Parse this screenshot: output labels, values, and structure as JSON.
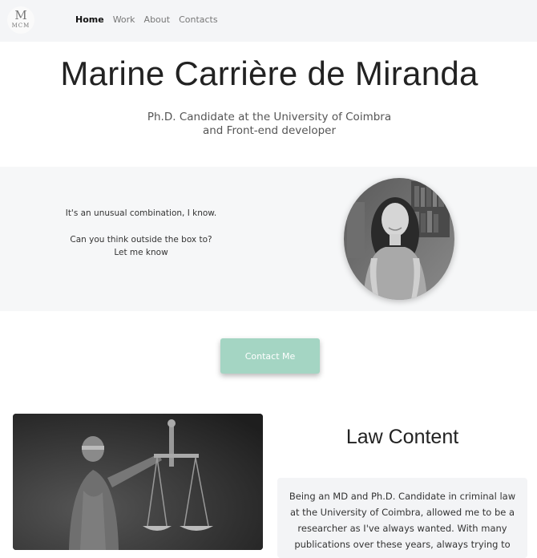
{
  "navbar": {
    "logo": {
      "initial": "M",
      "monogram": "MCM"
    },
    "links": [
      {
        "label": "Home",
        "active": true
      },
      {
        "label": "Work",
        "active": false
      },
      {
        "label": "About",
        "active": false
      },
      {
        "label": "Contacts",
        "active": false
      }
    ]
  },
  "hero": {
    "title": "Marine Carrière de Miranda",
    "subtitle_line1": "Ph.D. Candidate at the University of Coimbra",
    "subtitle_line2": "and Front-end developer"
  },
  "intro": {
    "line1": "It's an unusual combination, I know.",
    "line2": "Can you think outside the box to?",
    "line3": "Let me know"
  },
  "cta": {
    "label": "Contact Me"
  },
  "law": {
    "heading": "Law Content",
    "body": "Being an MD and Ph.D. Candidate in criminal law at the University of Coimbra, allowed me to be a researcher as I've always wanted. With many publications over these years, always trying to"
  },
  "colors": {
    "navbar_bg": "#f4f5f7",
    "band_bg": "#f6f7f8",
    "accent": "#a4d5c3"
  }
}
